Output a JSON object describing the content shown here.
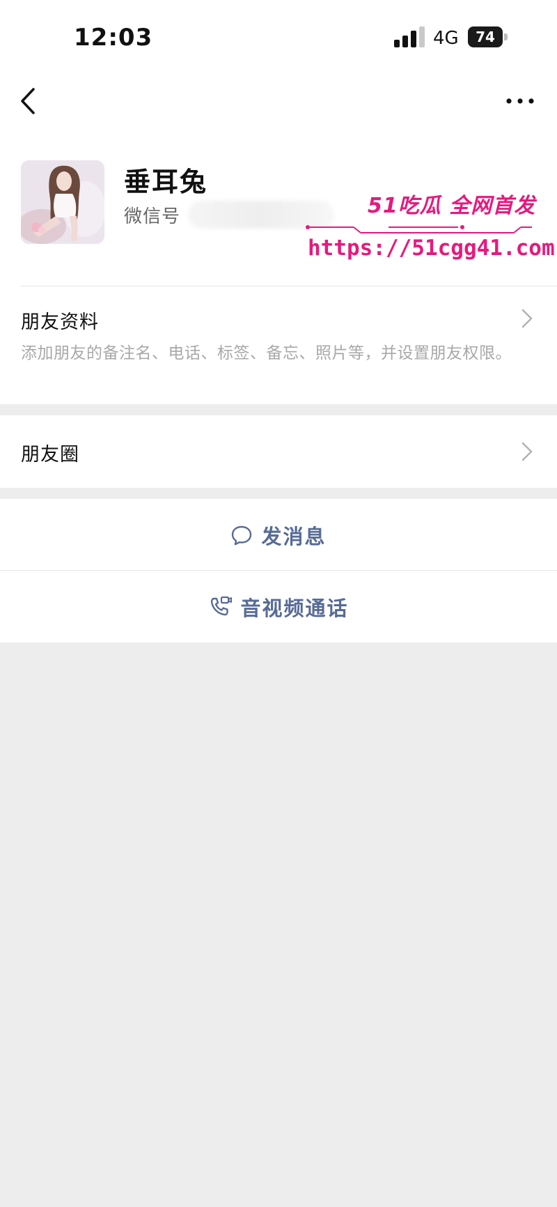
{
  "status_bar": {
    "time": "12:03",
    "network": "4G",
    "battery": "74"
  },
  "profile": {
    "nickname": "垂耳兔",
    "wechat_id_label": "微信号"
  },
  "watermark": {
    "logo": "51吃瓜 全网首发",
    "url": "https://51cgg41.com"
  },
  "friend_info": {
    "title": "朋友资料",
    "description": "添加朋友的备注名、电话、标签、备忘、照片等，并设置朋友权限。"
  },
  "moments": {
    "title": "朋友圈"
  },
  "actions": {
    "message": "发消息",
    "call": "音视频通话"
  },
  "colors": {
    "link": "#576b95",
    "background": "#ededed",
    "watermark": "#e6197e"
  },
  "icons": {
    "back": "chevron-left-icon",
    "more": "more-dots-icon",
    "message": "chat-bubble-icon",
    "call": "phone-video-icon",
    "chevron": "chevron-right-icon"
  }
}
